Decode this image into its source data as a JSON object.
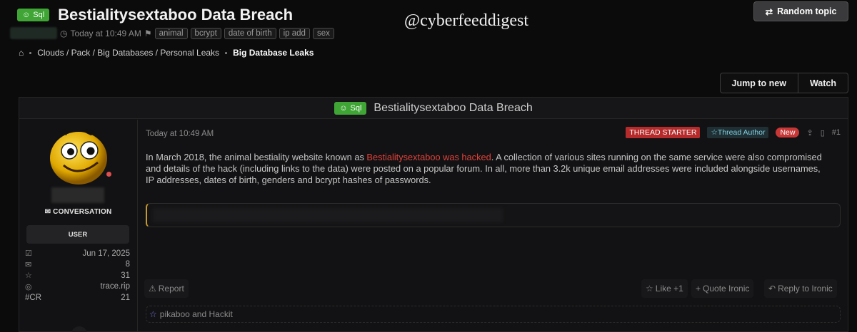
{
  "header": {
    "prefix": "Sql",
    "title": "Bestialitysextaboo Data Breach",
    "timestamp": "Today at 10:49 AM",
    "tags": [
      "animal",
      "bcrypt",
      "date of birth",
      "ip add",
      "sex"
    ],
    "watermark": "@cyberfeeddigest",
    "random_topic": "Random topic"
  },
  "breadcrumb": {
    "path": "Clouds / Pack / Big Databases / Personal Leaks",
    "current": "Big Database Leaks"
  },
  "actions": {
    "jump_to_new": "Jump to new",
    "watch": "Watch"
  },
  "post": {
    "prefix": "Sql",
    "title": "Bestialitysextaboo Data Breach",
    "date": "Today at 10:49 AM",
    "thread_starter": "THREAD STARTER",
    "thread_author": "Thread Author",
    "new_badge": "New",
    "number": "#1",
    "body_pre": "In March 2018, the animal bestiality website known as ",
    "body_link": "Bestialitysextaboo was hacked",
    "body_post": ". A collection of various sites running on the same service were also compromised and details of the hack (including links to the data) were posted on a popular forum. In all, more than 3.2k unique email addresses were included alongside usernames, IP addresses, dates of birth, genders and bcrypt hashes of passwords.",
    "report": "Report",
    "like": "Like +1",
    "quote": "Quote Ironic",
    "reply": "Reply to Ironic",
    "reactions": "pikaboo and Hackit"
  },
  "user": {
    "conversation": "CONVERSATION",
    "role": "USER",
    "joined": "Jun 17, 2025",
    "messages": "8",
    "reactions": "31",
    "website": "trace.rip",
    "cr_label": "#CR",
    "cr_value": "21"
  },
  "colors": {
    "accent_green": "#3fa535",
    "accent_red": "#e0423a"
  }
}
